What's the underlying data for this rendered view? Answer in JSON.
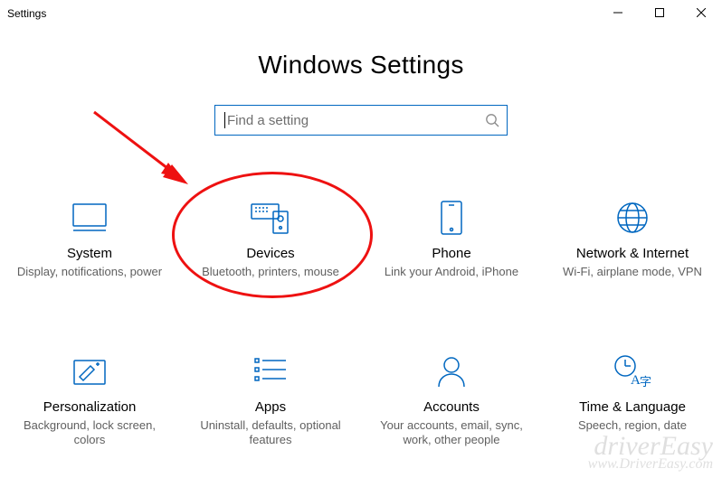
{
  "window_title": "Settings",
  "page_title": "Windows Settings",
  "search": {
    "placeholder": "Find a setting",
    "value": ""
  },
  "tiles": [
    {
      "title": "System",
      "subtitle": "Display, notifications, power",
      "icon": "system-icon"
    },
    {
      "title": "Devices",
      "subtitle": "Bluetooth, printers, mouse",
      "icon": "devices-icon"
    },
    {
      "title": "Phone",
      "subtitle": "Link your Android, iPhone",
      "icon": "phone-icon"
    },
    {
      "title": "Network & Internet",
      "subtitle": "Wi-Fi, airplane mode, VPN",
      "icon": "network-icon"
    },
    {
      "title": "Personalization",
      "subtitle": "Background, lock screen, colors",
      "icon": "personalization-icon"
    },
    {
      "title": "Apps",
      "subtitle": "Uninstall, defaults, optional features",
      "icon": "apps-icon"
    },
    {
      "title": "Accounts",
      "subtitle": "Your accounts, email, sync, work, other people",
      "icon": "accounts-icon"
    },
    {
      "title": "Time & Language",
      "subtitle": "Speech, region, date",
      "icon": "time-language-icon"
    }
  ],
  "watermark": {
    "line1": "driverEasy",
    "line2": "www.DriverEasy.com"
  },
  "annotation": {
    "target_tile_index": 1
  }
}
